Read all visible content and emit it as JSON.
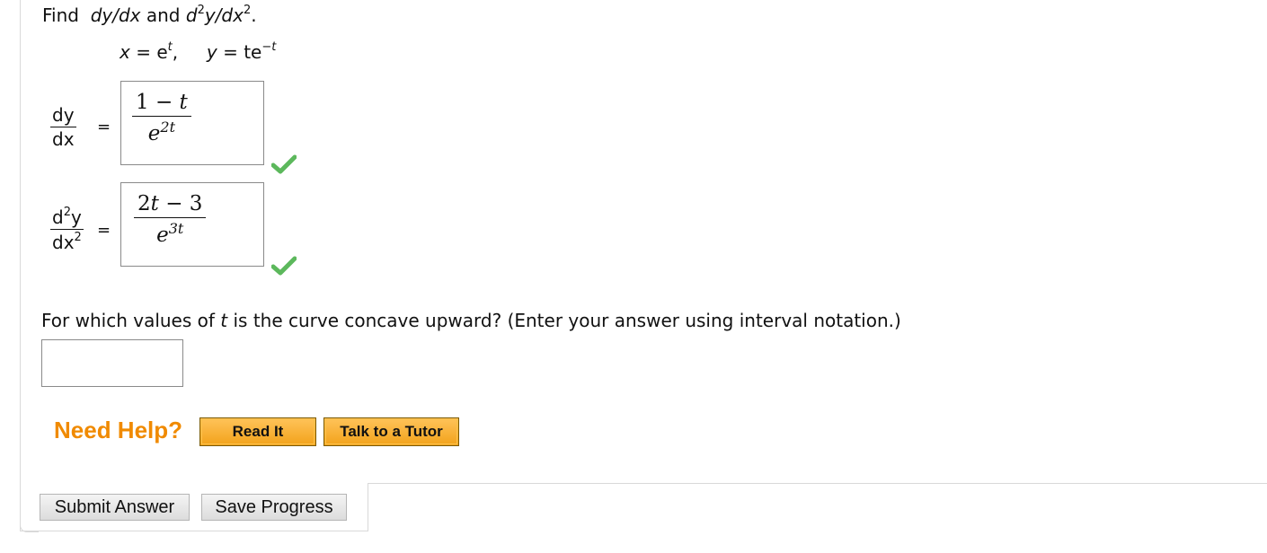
{
  "question": {
    "find_word": "Find",
    "find_dydx": "dy/dx",
    "find_and": "and",
    "find_d2y": "d",
    "find_sup1": "2",
    "find_y_over_dx": "y/dx",
    "find_sup2": "2",
    "find_period": "."
  },
  "equations": {
    "x_lhs": "x",
    "x_eq": "= e",
    "x_exp": "t",
    "comma": ",",
    "y_lhs": "y",
    "y_eq": "= te",
    "y_exp": "−t"
  },
  "part1": {
    "lhs_num": "dy",
    "lhs_den": "dx",
    "equals": "=",
    "answer_num_1": "1 − ",
    "answer_num_t": "t",
    "answer_den_base": "e",
    "answer_den_exp": "2t",
    "status_icon": "checkmark-icon"
  },
  "part2": {
    "lhs_num_d": "d",
    "lhs_num_sup": "2",
    "lhs_num_y": "y",
    "lhs_den_dx": "dx",
    "lhs_den_sup": "2",
    "equals": "=",
    "answer_num_2": "2",
    "answer_num_t": "t",
    "answer_num_rest": " − 3",
    "answer_den_base": "e",
    "answer_den_exp": "3t",
    "status_icon": "checkmark-icon"
  },
  "concave": {
    "text_before": "For which values of ",
    "text_t": "t",
    "text_after": " is the curve concave upward? (Enter your answer using interval notation.)",
    "input_value": ""
  },
  "help": {
    "label": "Need Help?",
    "read_it": "Read It",
    "talk_tutor": "Talk to a Tutor"
  },
  "actions": {
    "submit": "Submit Answer",
    "save": "Save Progress"
  },
  "colors": {
    "help_orange": "#f08a00",
    "check_green": "#5cb85c",
    "button_orange": "#f2a21a"
  }
}
